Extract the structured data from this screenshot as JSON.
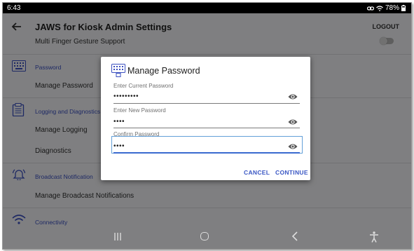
{
  "status": {
    "time": "6:43",
    "battery": "78%"
  },
  "appbar": {
    "title": "JAWS for Kiosk Admin Settings",
    "logout_label": "LOGOUT"
  },
  "settings": {
    "multi_finger_label": "Multi Finger Gesture Support",
    "password_section": "Password",
    "manage_password": "Manage Password",
    "logging_section": "Logging and Diagnostics",
    "manage_logging": "Manage Logging",
    "diagnostics": "Diagnostics",
    "broadcast_section": "Broadcast Notification",
    "manage_broadcast": "Manage Broadcast Notifications",
    "connectivity_section": "Connectivity"
  },
  "dialog": {
    "title": "Manage Password",
    "fields": [
      {
        "label": "Enter Current Password",
        "value": "•••••••••"
      },
      {
        "label": "Enter New Password",
        "value": "••••"
      },
      {
        "label": "Confirm Password",
        "value": "••••"
      }
    ],
    "cancel_label": "CANCEL",
    "continue_label": "CONTINUE"
  },
  "colors": {
    "accent": "#3a57c4",
    "focus": "#63a0d9",
    "statusbar": "#000000"
  },
  "icons": [
    "back-arrow-icon",
    "keypad-icon",
    "clipboard-icon",
    "bell-icon",
    "wifi-icon",
    "eye-icon",
    "accessibility-icon"
  ]
}
